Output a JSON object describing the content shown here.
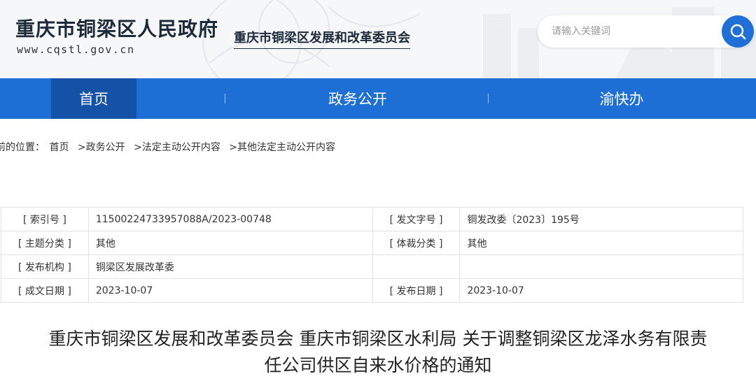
{
  "header": {
    "site_title": "重庆市铜梁区人民政府",
    "site_url": "www.cqstl.gov.cn",
    "department": "重庆市铜梁区发展和改革委员会",
    "search_placeholder": "请输入关键词",
    "accent_color": "#1d6fd5"
  },
  "nav": {
    "items": [
      {
        "label": "首页",
        "active": true
      },
      {
        "label": "政务公开",
        "active": false
      },
      {
        "label": "渝快办",
        "active": false
      }
    ]
  },
  "breadcrumb": {
    "prefix": "前的位置：",
    "items": [
      "首页",
      ">政务公开",
      ">法定主动公开内容",
      ">其他法定主动公开内容"
    ]
  },
  "info": {
    "rows": [
      {
        "label1": "[ 索引号 ]",
        "value1": "11500224733957088A/2023-00748",
        "label2": "[ 发文字号 ]",
        "value2": "铜发改委〔2023〕195号"
      },
      {
        "label1": "[ 主题分类 ]",
        "value1": "其他",
        "label2": "[ 体裁分类 ]",
        "value2": "其他"
      },
      {
        "label1": "[ 发布机构 ]",
        "value1": "铜梁区发展改革委",
        "label2": "",
        "value2": ""
      },
      {
        "label1": "[ 成文日期 ]",
        "value1": "2023-10-07",
        "label2": "[ 发布日期 ]",
        "value2": "2023-10-07"
      }
    ]
  },
  "document": {
    "title_line1": "重庆市铜梁区发展和改革委员会 重庆市铜梁区水利局 关于调整铜梁区龙泽水务有限责",
    "title_line2": "任公司供区自来水价格的通知"
  }
}
